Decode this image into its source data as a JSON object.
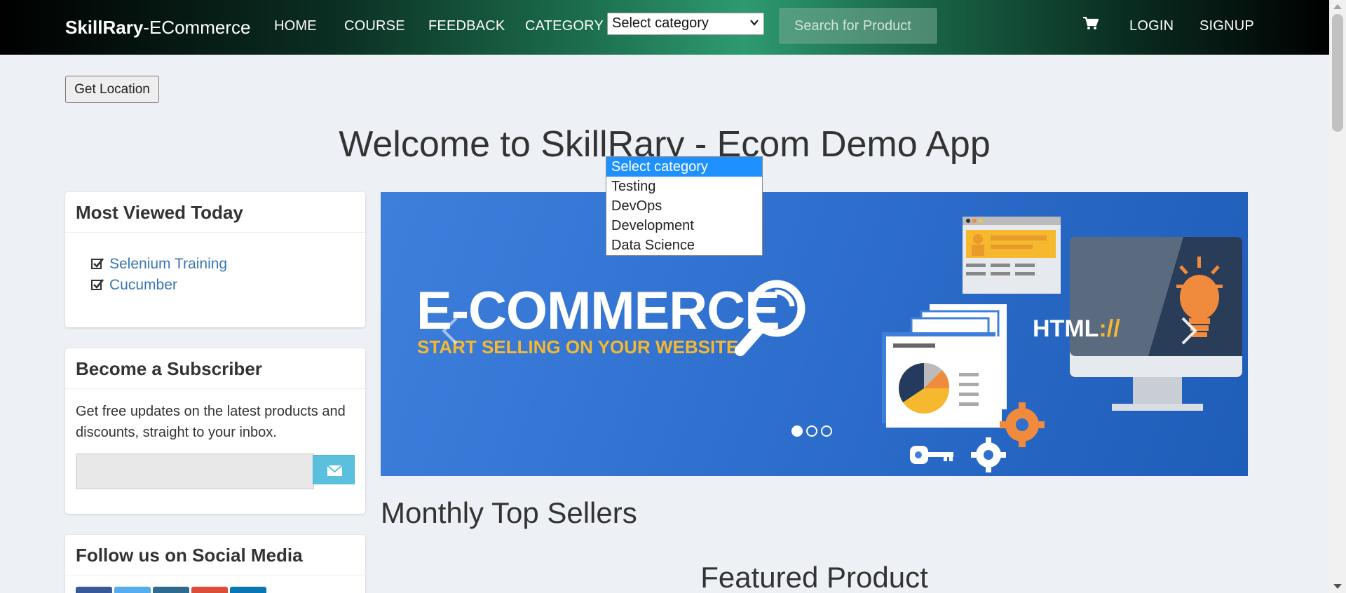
{
  "navbar": {
    "brand_bold": "SkillRary",
    "brand_rest": "-ECommerce",
    "links": [
      "HOME",
      "COURSE",
      "FEEDBACK",
      "CATEGORY"
    ],
    "category_select_value": "Select category",
    "search_placeholder": "Search for Product",
    "login": "LOGIN",
    "signup": "SIGNUP"
  },
  "get_location_label": "Get Location",
  "welcome_title": "Welcome to SkillRary - Ecom Demo App",
  "most_viewed": {
    "title": "Most Viewed Today",
    "items": [
      "Selenium Training",
      "Cucumber"
    ]
  },
  "subscriber": {
    "title": "Become a Subscriber",
    "text": "Get free updates on the latest products and discounts, straight to your inbox."
  },
  "social": {
    "title": "Follow us on Social Media",
    "colors": [
      "#3b5998",
      "#55acee",
      "#2e6b8f",
      "#dd4b39",
      "#0976b4"
    ]
  },
  "carousel": {
    "title": "E-COMMERCE",
    "subtitle": "START SELLING ON YOUR WEBSITE",
    "monitor_text": "HTML",
    "monitor_accent": "://",
    "active_slide": 1,
    "slide_count": 3
  },
  "headings": {
    "monthly_top_sellers": "Monthly Top Sellers",
    "featured_product": "Featured Product"
  },
  "category_dropdown": {
    "options": [
      "Select category",
      "Testing",
      "DevOps",
      "Development",
      "Data Science"
    ],
    "selected_index": 0
  },
  "colors": {
    "link": "#3a76b4",
    "highlight": "#1e90ff",
    "accent_orange": "#f5b82e",
    "subscribe_button": "#5bc0de"
  }
}
